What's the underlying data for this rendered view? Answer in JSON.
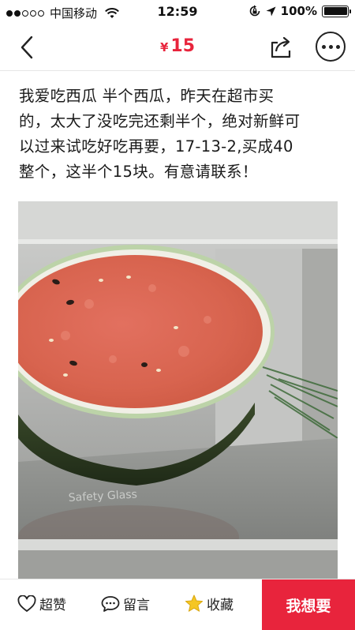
{
  "status_bar": {
    "carrier": "中国移动",
    "time": "12:59",
    "battery_text": "100%",
    "battery_level": 1.0,
    "signal_bars_filled": 2,
    "signal_bars_total": 5
  },
  "nav": {
    "currency": "¥",
    "price": "15",
    "price_color": "#e8243c"
  },
  "listing": {
    "description_lines": [
      "我爱吃西瓜 半个西瓜，昨天在超市买",
      "的，太大了没吃完还剩半个，绝对新鲜可",
      "以过来试吃好吃再要，17-13-2,买成40",
      "整个，这半个15块。有意请联系！"
    ],
    "photo": {
      "glass_label": "Safety Glass"
    }
  },
  "bottom_bar": {
    "like_label": "超赞",
    "comment_label": "留言",
    "favorite_label": "收藏",
    "want_label": "我想要",
    "accent": "#e8243c",
    "star_color": "#f5c623"
  },
  "icons": [
    "wifi-icon",
    "lock-rotation-icon",
    "location-arrow-icon",
    "battery-icon",
    "back-chevron-icon",
    "share-icon",
    "more-icon",
    "heart-icon",
    "comment-icon",
    "star-icon"
  ]
}
